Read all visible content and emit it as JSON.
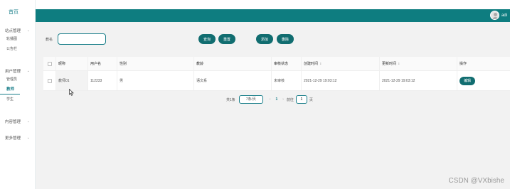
{
  "sidebar": {
    "home": "首页",
    "groups": [
      {
        "title": "站点管理",
        "items": [
          "轮播图",
          "公告栏"
        ]
      },
      {
        "title": "用户管理",
        "items": [
          "管理员",
          "教师",
          "学生"
        ]
      },
      {
        "title": "内容管理",
        "items": []
      },
      {
        "title": "更多管理",
        "items": []
      }
    ]
  },
  "topbar": {
    "username": "adi"
  },
  "toolbar": {
    "search_label": "教名",
    "search_value": "",
    "query_label": "查询",
    "reset_label": "重置",
    "add_label": "添加",
    "delete_label": "删除"
  },
  "table": {
    "columns": [
      "昵称",
      "用户名",
      "性别",
      "教龄",
      "审核状态",
      "创建时间",
      "更新时间",
      "操作"
    ],
    "rows": [
      {
        "nickname": "教师01",
        "username": "112233",
        "gender": "男",
        "teaching_age": "语文系",
        "status": "未审核",
        "created": "2021-12-29 19:03:12",
        "updated": "2021-12-29 19:03:12",
        "action": "编辑"
      }
    ]
  },
  "pagination": {
    "total": "共1条",
    "page_size": "7条/页",
    "current": "1",
    "goto_prefix": "前往",
    "goto_value": "1",
    "goto_suffix": "页"
  },
  "watermark": "CSDN @VXbishe",
  "colors": {
    "accent": "#0e7d80",
    "button": "#116d70",
    "background": "#f2f2f2"
  }
}
